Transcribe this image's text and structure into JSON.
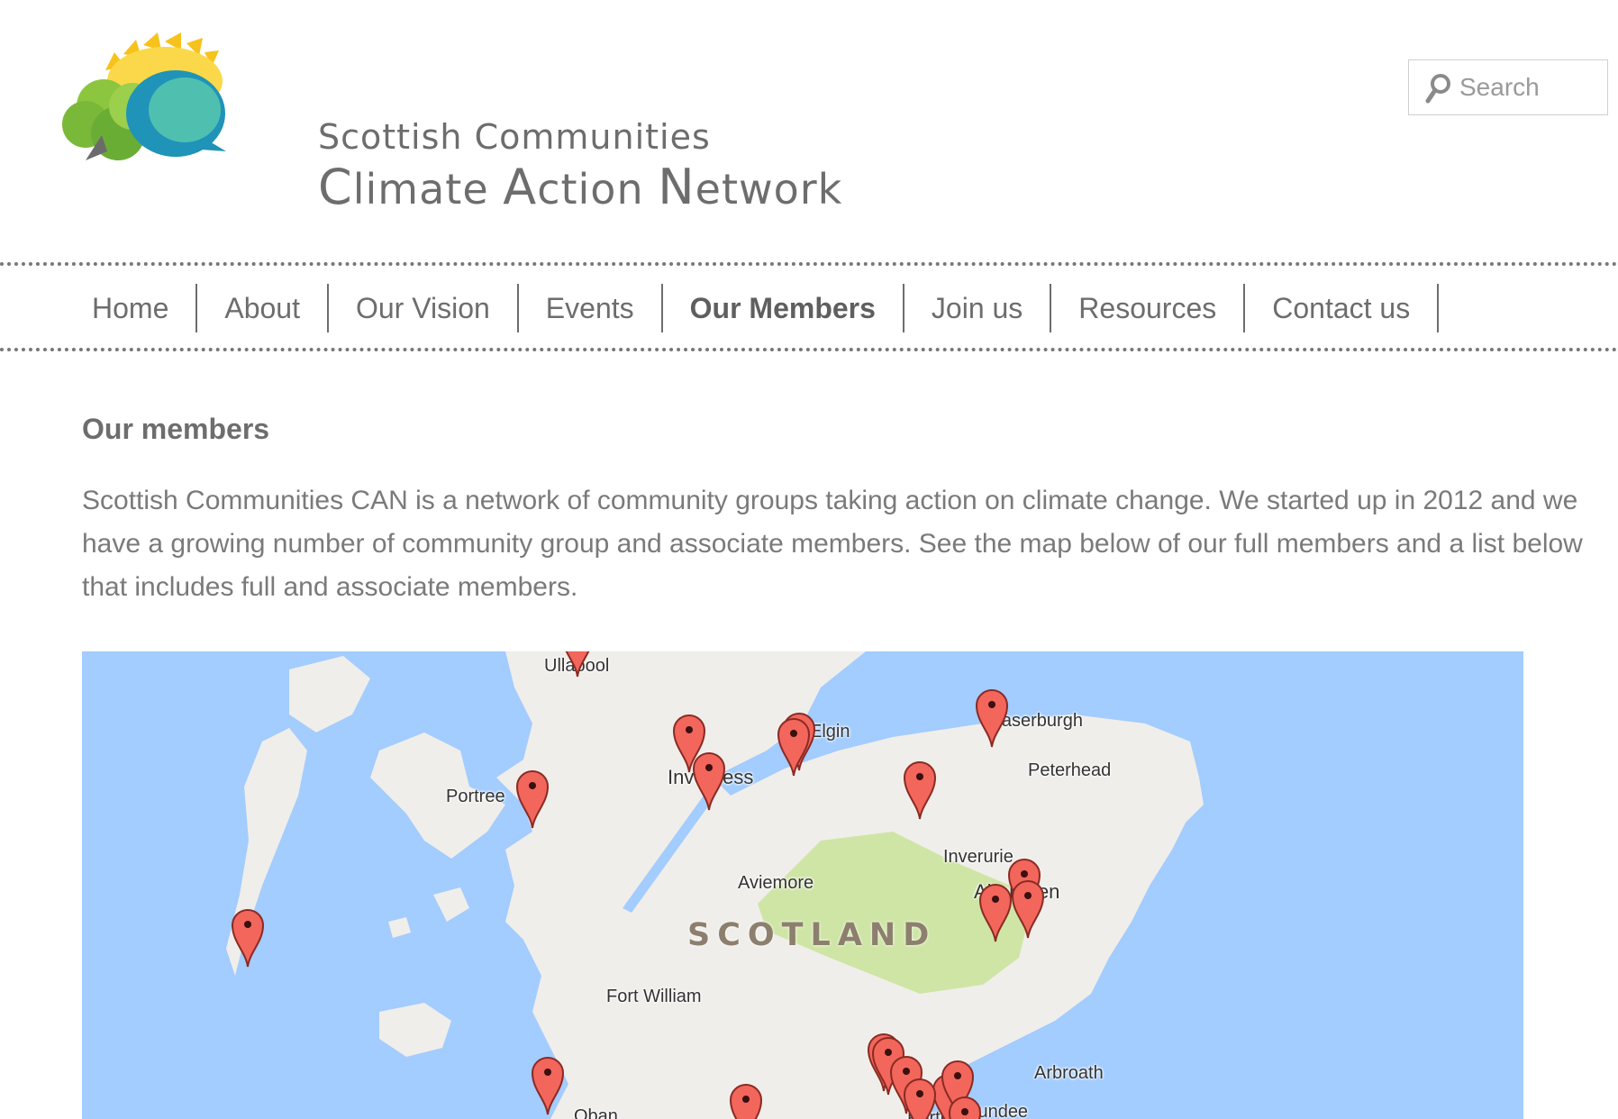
{
  "header": {
    "logo": {
      "line1": "Scottish Communities",
      "line2_parts": [
        "C",
        "limate ",
        "A",
        "ction ",
        "N",
        "etwork"
      ]
    },
    "search": {
      "placeholder": "Search",
      "icon": "search-icon"
    }
  },
  "nav": {
    "items": [
      {
        "label": "Home"
      },
      {
        "label": "About"
      },
      {
        "label": "Our Vision"
      },
      {
        "label": "Events"
      },
      {
        "label": "Our Members",
        "active": true
      },
      {
        "label": "Join us"
      },
      {
        "label": "Resources"
      },
      {
        "label": "Contact us"
      }
    ]
  },
  "main": {
    "title": "Our members",
    "intro": "Scottish Communities CAN is a network of community groups taking action on climate change. We started up in 2012 and we have a growing number of community group and associate members. See the map below of our full members and a list below that includes full and associate members."
  },
  "map": {
    "country_label": "SCOTLAND",
    "places": [
      "Ullapool",
      "Elgin",
      "Fraserburgh",
      "Inverness",
      "Peterhead",
      "Portree",
      "Inverurie",
      "Aberdeen",
      "Aviemore",
      "Fort William",
      "Arbroath",
      "Oban",
      "Perth",
      "Dundee"
    ],
    "colors": {
      "sea": "#a3ccff",
      "land": "#f0eeea",
      "park": "#cfe5a6",
      "pin": "#f2665c"
    },
    "marker_icon": "map-pin-icon"
  }
}
